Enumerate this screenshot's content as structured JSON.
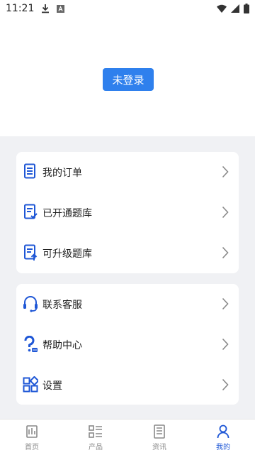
{
  "status_bar": {
    "time": "11:21"
  },
  "login": {
    "button_label": "未登录"
  },
  "menu_group_1": [
    {
      "label": "我的订单",
      "icon": "order-icon"
    },
    {
      "label": "已开通题库",
      "icon": "question-bank-opened-icon"
    },
    {
      "label": "可升级题库",
      "icon": "question-bank-upgrade-icon"
    }
  ],
  "menu_group_2": [
    {
      "label": "联系客服",
      "icon": "headset-icon"
    },
    {
      "label": "帮助中心",
      "icon": "help-icon"
    },
    {
      "label": "设置",
      "icon": "settings-grid-icon"
    }
  ],
  "tabs": [
    {
      "label": "首页",
      "icon": "home-icon",
      "active": false
    },
    {
      "label": "产品",
      "icon": "products-icon",
      "active": false
    },
    {
      "label": "资讯",
      "icon": "news-icon",
      "active": false
    },
    {
      "label": "我的",
      "icon": "profile-icon",
      "active": true
    }
  ],
  "colors": {
    "accent": "#2f80ed",
    "icon_blue": "#1f57d6",
    "background": "#f0f1f4"
  }
}
